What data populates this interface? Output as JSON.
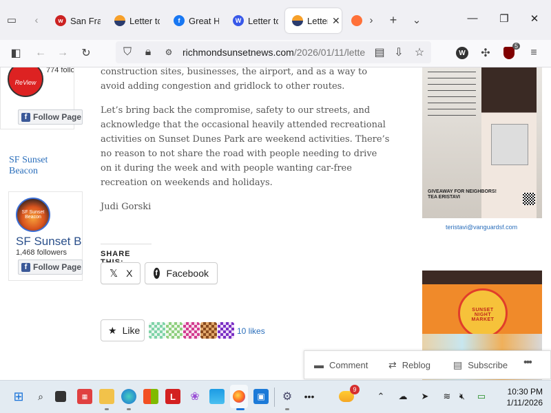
{
  "browser": {
    "tabs": [
      {
        "label": "San Fran",
        "favicon": "wu-icon",
        "color": "#cc2222"
      },
      {
        "label": "Letter to",
        "favicon": "sunset-icon",
        "color": "#e07a1f"
      },
      {
        "label": "Great Hi",
        "favicon": "facebook-icon",
        "color": "#1877f2"
      },
      {
        "label": "Letter to",
        "favicon": "wordpress-icon",
        "color": "#3858e9"
      },
      {
        "label": "Letter",
        "favicon": "sunset-icon",
        "color": "#e07a1f",
        "active": true
      },
      {
        "label": "",
        "favicon": "firefox-icon",
        "color": "#ff7139"
      }
    ],
    "url_domain": "richmondsunsetnews.com",
    "url_path": "/2026/01/11/lette",
    "extension_badge": "5"
  },
  "sidebar": {
    "widget1_followers": "774 follo",
    "widget1_follow_label": "Follow Page",
    "widget1_logo_text": "ReView",
    "beacon_title": "SF Sunset Beacon",
    "widget2_logo_text": "SF Sunset Beacon",
    "widget2_name": "SF Sunset B",
    "widget2_followers": "1,468 followers",
    "widget2_follow_label": "Follow Page"
  },
  "article": {
    "para1": "construction sites, businesses, the airport, and as a way to avoid adding congestion and gridlock to other routes.",
    "para2": "Let’s bring back the compromise, safety to our streets, and acknowledge that the occasional heavily attended recreational activities on Sunset Dunes Park are weekend activities. There’s no reason to not share the road with people needing to drive on it during the week and with people wanting car-free recreation on weekends and holidays.",
    "author": "Judi Gorski"
  },
  "share": {
    "label": "SHARE THIS:",
    "x_label": "X",
    "facebook_label": "Facebook"
  },
  "likes": {
    "like_label": "Like",
    "count": "10 likes"
  },
  "ads": {
    "ad1_email": "teristavi@vanguardsf.com",
    "ad1_name": "TEA ERISTAVI",
    "ad1_tagline": "GIVEAWAY FOR NEIGHBORS!",
    "ad2_title": "SUNSET NIGHT MARKET"
  },
  "action_bar": {
    "comment": "Comment",
    "reblog": "Reblog",
    "subscribe": "Subscribe",
    "more": "•••"
  },
  "taskbar": {
    "time": "10:30 PM",
    "date": "1/11/2026",
    "weather_badge": "9"
  }
}
